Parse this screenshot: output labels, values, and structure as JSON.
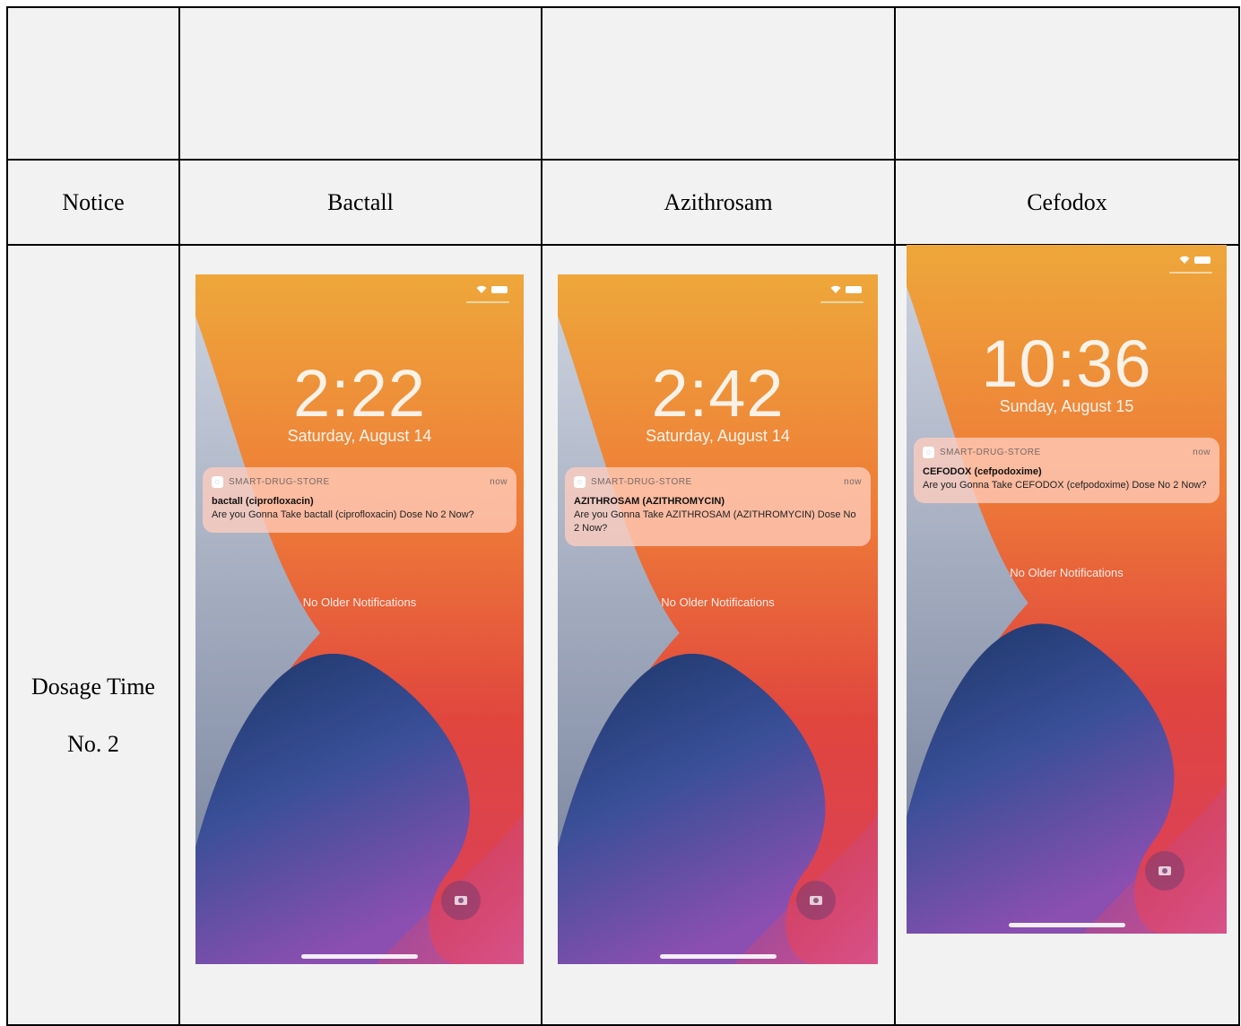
{
  "headers": {
    "notice": "Notice",
    "bactall": "Bactall",
    "azithrosam": "Azithrosam",
    "cefodox": "Cefodox"
  },
  "row_label": {
    "line1": "Dosage Time",
    "line2": "No. 2"
  },
  "phones": [
    {
      "time": "2:22",
      "date": "Saturday, August 14",
      "app_name": "SMART-DRUG-STORE",
      "when": "now",
      "title": "bactall (ciprofloxacin)",
      "body": "Are you Gonna Take bactall (ciprofloxacin)  Dose No 2 Now?",
      "no_older": "No Older Notifications"
    },
    {
      "time": "2:42",
      "date": "Saturday, August 14",
      "app_name": "SMART-DRUG-STORE",
      "when": "now",
      "title": "AZITHROSAM (AZITHROMYCIN)",
      "body": "Are you Gonna Take AZITHROSAM (AZITHROMYCIN) Dose No 2 Now?",
      "no_older": "No Older Notifications"
    },
    {
      "time": "10:36",
      "date": "Sunday, August 15",
      "app_name": "SMART-DRUG-STORE",
      "when": "now",
      "title": "CEFODOX (cefpodoxime)",
      "body": "Are you Gonna Take CEFODOX (cefpodoxime) Dose No 2 Now?",
      "no_older": "No Older Notifications"
    }
  ],
  "icons": {
    "app": "smart-drug-store-app-icon",
    "camera": "camera-icon",
    "wifi": "wifi-icon",
    "battery": "battery-icon"
  },
  "colors": {
    "cell_bg": "#f2f2f2",
    "border": "#000000",
    "wallpaper_top": "#f2a73a",
    "wallpaper_red": "#e0453e",
    "wallpaper_blue": "#203a7a",
    "wallpaper_purple": "#8a4fb0",
    "notification_bg": "#ffcdbe"
  }
}
